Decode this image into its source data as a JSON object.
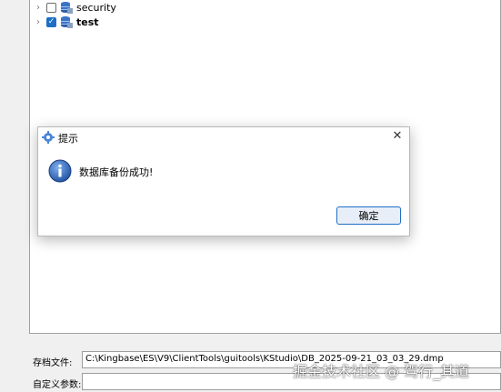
{
  "tree": {
    "items": [
      {
        "label": "security",
        "checked": false
      },
      {
        "label": "test",
        "checked": true
      }
    ]
  },
  "dialog": {
    "title": "提示",
    "message": "数据库备份成功!",
    "ok_label": "确定",
    "close_glyph": "✕"
  },
  "form": {
    "archive_label": "存档文件:",
    "archive_value": "C:\\Kingbase\\ES\\V9\\ClientTools\\guitools\\KStudio\\DB_2025-09-21_03_03_29.dmp",
    "params_label": "自定义参数:",
    "params_value": ""
  },
  "watermark": "掘金技术社区 @ 驾行_其道",
  "colors": {
    "accent": "#1f6fc6",
    "info": "#2a5db0"
  }
}
